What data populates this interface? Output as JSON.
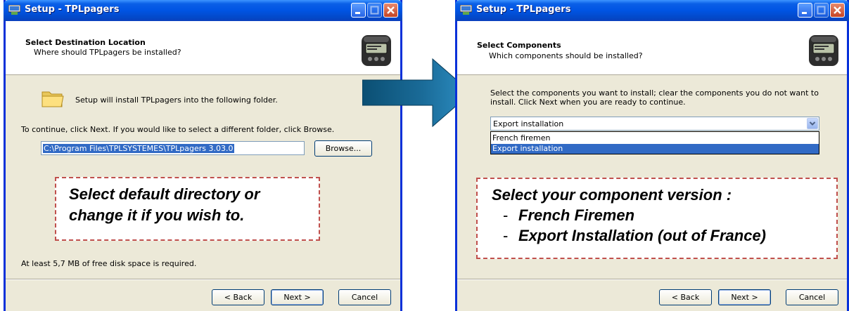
{
  "left_window": {
    "title": "Setup - TPLpagers",
    "header_title": "Select Destination Location",
    "header_subtitle": "Where should TPLpagers be installed?",
    "install_text": "Setup will install TPLpagers into the following folder.",
    "continue_text": "To continue, click Next. If you would like to select a different folder, click Browse.",
    "path_value": "C:\\Program Files\\TPLSYSTEMES\\TPLpagers 3.03.0",
    "browse_label": "Browse...",
    "callout_lines": [
      "Select default directory or",
      "change it if you wish to."
    ],
    "disk_space_text": "At least 5,7 MB of free disk space is required.",
    "back_label": "< Back",
    "next_label": "Next >",
    "cancel_label": "Cancel"
  },
  "right_window": {
    "title": "Setup - TPLpagers",
    "header_title": "Select Components",
    "header_subtitle": "Which components should be installed?",
    "instructions_line1": "Select the components you want to install; clear the components you do not want to",
    "instructions_line2": "install. Click Next when you are ready to continue.",
    "combo_value": "Export installation",
    "options": [
      "French firemen",
      "Export installation"
    ],
    "selected_option_index": 1,
    "callout_title": "Select your component version :",
    "callout_items": [
      "French Firemen",
      "Export Installation (out of France)"
    ],
    "callout_bullet": "-",
    "back_label": "< Back",
    "next_label": "Next >",
    "cancel_label": "Cancel"
  },
  "colors": {
    "titlebar_blue": "#0054e3",
    "selection_blue": "#316ac5",
    "callout_border": "#c0504d",
    "arrow_gradient": [
      "#0b4f73",
      "#2d8fc4"
    ]
  }
}
